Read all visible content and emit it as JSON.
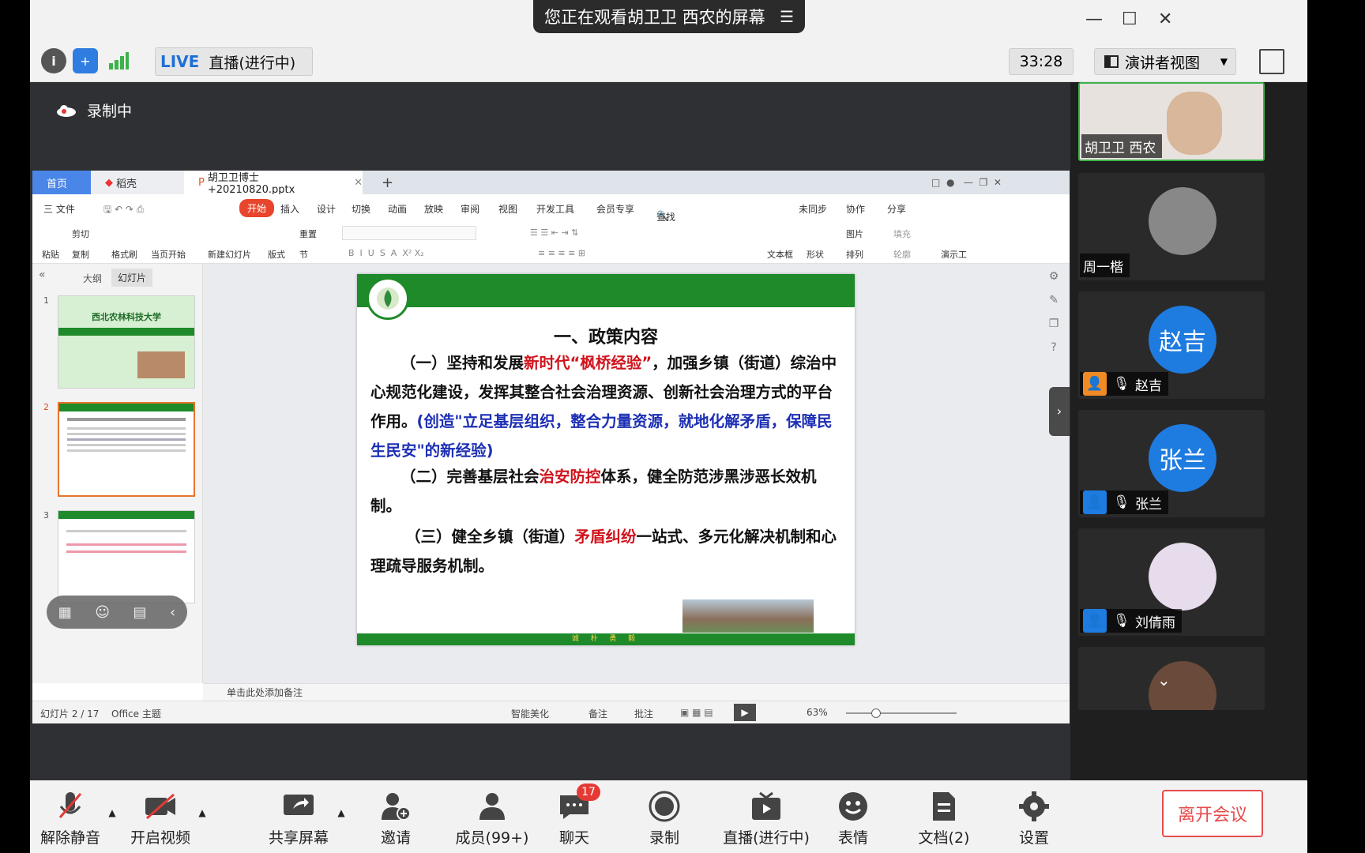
{
  "window": {
    "share_text": "您正在观看胡卫卫 西农的屏幕"
  },
  "toolbar": {
    "live_tag": "LIVE",
    "live_status": "直播(进行中)",
    "timer": "33:28",
    "view_mode": "演讲者视图"
  },
  "stage": {
    "recording": "录制中"
  },
  "wps": {
    "tabs": [
      "首页",
      "稻壳",
      "胡卫卫博士+20210820.pptx"
    ],
    "menus": [
      "三 文件",
      "开始",
      "插入",
      "设计",
      "切换",
      "动画",
      "放映",
      "审阅",
      "视图",
      "开发工具",
      "会员专享",
      "查找命令、搜索模板",
      "未同步",
      "协作",
      "分享"
    ],
    "ribbon": [
      "粘贴",
      "剪切",
      "复制",
      "格式刷",
      "当页开始",
      "新建幻灯片",
      "版式",
      "节",
      "重置",
      "文本框",
      "形状",
      "图片",
      "排列",
      "填充",
      "轮廓",
      "演示工"
    ],
    "panel_tabs": [
      "大纲",
      "幻灯片"
    ],
    "thumb1_title": "西北农林科技大学",
    "slide": {
      "title": "一、政策内容",
      "p1_a": "（一）坚持和发展",
      "p1_red": "新时代“枫桥经验”",
      "p1_b": "，加强乡镇（街道）综治中心规范化建设，发挥其整合社会治理资源、创新社会治理方式的平台作用。",
      "p1_blue": "(创造\"立足基层组织，整合力量资源，就地化解矛盾，保障民生民安\"的新经验)",
      "p2_a": "（二）完善基层社会",
      "p2_red": "治安防控",
      "p2_b": "体系，健全防范涉黑涉恶长效机制。",
      "p3_a": "（三）健全乡镇（街道）",
      "p3_red": "矛盾纠纷",
      "p3_b": "一站式、多元化解决机制和心理疏导服务机制。",
      "footer": "诚 朴 勇 毅"
    },
    "notes": "单击此处添加备注",
    "status": {
      "slide_no": "幻灯片 2 / 17",
      "theme": "Office 主题",
      "beautify": "智能美化",
      "remarks": "备注",
      "comment": "批注",
      "zoom": "63%"
    }
  },
  "participants": [
    {
      "name": "胡卫卫 西农",
      "type": "video"
    },
    {
      "name": "周一楷",
      "type": "photo"
    },
    {
      "name": "赵吉",
      "avatar": "赵吉",
      "color": "#1e7be0",
      "badge_color": "#f08a24"
    },
    {
      "name": "张兰",
      "avatar": "张兰",
      "color": "#1e7be0",
      "badge_color": "#1e7be0"
    },
    {
      "name": "刘倩雨",
      "type": "photo",
      "badge_color": "#1e7be0"
    }
  ],
  "bottombar": {
    "unmute": "解除静音",
    "video": "开启视频",
    "share": "共享屏幕",
    "invite": "邀请",
    "members": "成员(99+)",
    "chat": "聊天",
    "chat_count": "17",
    "record": "录制",
    "live": "直播(进行中)",
    "emoji": "表情",
    "docs": "文档(2)",
    "settings": "设置",
    "leave": "离开会议"
  }
}
